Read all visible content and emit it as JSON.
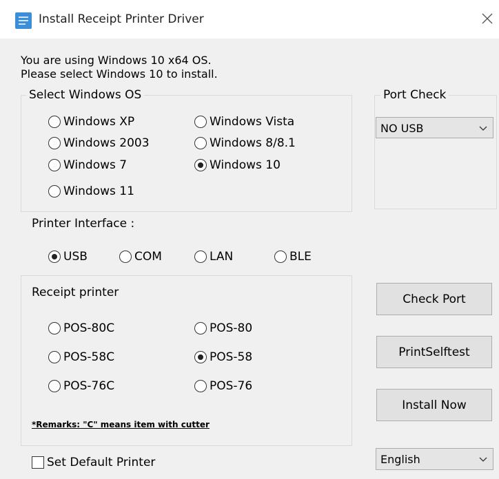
{
  "window": {
    "title": "Install Receipt Printer Driver"
  },
  "info": {
    "line1": "You are using Windows 10 x64 OS.",
    "line2": "Please select Windows 10 to install."
  },
  "os_group": {
    "title": "Select Windows OS",
    "options": [
      {
        "label": "Windows XP",
        "selected": false
      },
      {
        "label": "Windows Vista",
        "selected": false
      },
      {
        "label": "Windows 2003",
        "selected": false
      },
      {
        "label": "Windows 8/8.1",
        "selected": false
      },
      {
        "label": "Windows 7",
        "selected": false
      },
      {
        "label": "Windows 10",
        "selected": true
      },
      {
        "label": "Windows 11",
        "selected": false
      }
    ]
  },
  "port_check": {
    "title": "Port Check",
    "selected": "NO USB"
  },
  "interface": {
    "label": "Printer Interface :",
    "options": [
      {
        "label": "USB",
        "selected": true
      },
      {
        "label": "COM",
        "selected": false
      },
      {
        "label": "LAN",
        "selected": false
      },
      {
        "label": "BLE",
        "selected": false
      }
    ]
  },
  "printer_group": {
    "title": "Receipt printer",
    "options": [
      {
        "label": "POS-80C",
        "selected": false
      },
      {
        "label": "POS-80",
        "selected": false
      },
      {
        "label": "POS-58C",
        "selected": false
      },
      {
        "label": "POS-58",
        "selected": true
      },
      {
        "label": "POS-76C",
        "selected": false
      },
      {
        "label": "POS-76",
        "selected": false
      }
    ],
    "remark": "*Remarks: \"C\" means item with cutter"
  },
  "buttons": {
    "check_port": "Check Port",
    "self_test": "PrintSelftest",
    "install_now": "Install Now"
  },
  "default_printer": {
    "label": "Set Default Printer",
    "checked": false
  },
  "language": {
    "selected": "English"
  }
}
